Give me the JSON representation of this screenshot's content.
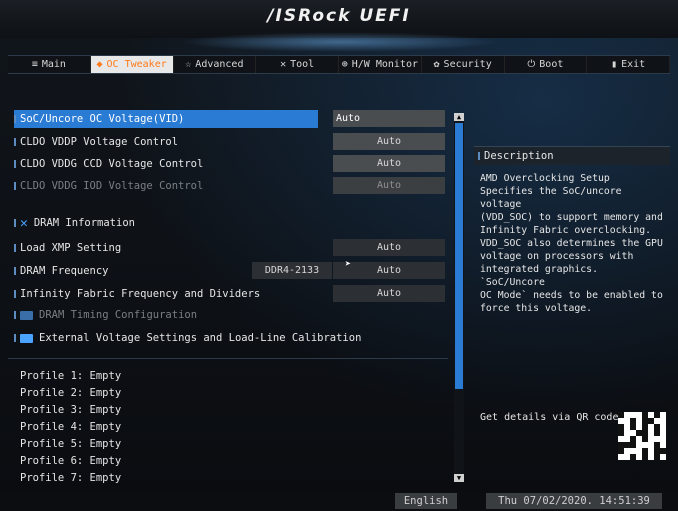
{
  "header": {
    "logo": "/ISRock UEFI"
  },
  "tabs": [
    {
      "label": "Main",
      "icon": "≡"
    },
    {
      "label": "OC Tweaker",
      "icon": "◆"
    },
    {
      "label": "Advanced",
      "icon": "☆"
    },
    {
      "label": "Tool",
      "icon": "✕"
    },
    {
      "label": "H/W Monitor",
      "icon": "⊕"
    },
    {
      "label": "Security",
      "icon": "✿"
    },
    {
      "label": "Boot",
      "icon": "⏻"
    },
    {
      "label": "Exit",
      "icon": "▮"
    }
  ],
  "settings": [
    {
      "label": "SoC/Uncore OC Voltage(VID)",
      "value": "Auto"
    },
    {
      "label": "CLDO VDDP Voltage Control",
      "value": "Auto"
    },
    {
      "label": "CLDO VDDG CCD Voltage Control",
      "value": "Auto"
    },
    {
      "label": "CLDO VDDG IOD Voltage Control",
      "value": "Auto"
    },
    {
      "label": "DRAM Information"
    },
    {
      "label": "Load XMP Setting",
      "value": "Auto"
    },
    {
      "label": "DRAM Frequency",
      "readout": "DDR4-2133",
      "value": "Auto"
    },
    {
      "label": "Infinity Fabric Frequency and Dividers",
      "value": "Auto"
    },
    {
      "label": "DRAM Timing Configuration"
    },
    {
      "label": "External Voltage Settings and Load-Line Calibration"
    }
  ],
  "profiles": [
    "Profile 1: Empty",
    "Profile 2: Empty",
    "Profile 3: Empty",
    "Profile 4: Empty",
    "Profile 5: Empty",
    "Profile 6: Empty",
    "Profile 7: Empty"
  ],
  "description": {
    "title": "Description",
    "text": "AMD Overclocking Setup\nSpecifies the SoC/uncore voltage\n(VDD_SOC) to support memory and\nInfinity Fabric overclocking.\nVDD_SOC also determines the GPU\nvoltage on processors with\nintegrated graphics. `SoC/Uncore\nOC Mode` needs to be enabled to\nforce this voltage.",
    "qr_label": "Get details via QR code"
  },
  "footer": {
    "language": "English",
    "datetime": "Thu 07/02/2020. 14:51:39"
  },
  "colors": {
    "accent": "#2a7bd4",
    "active_tab_text": "#ff7a1a"
  }
}
